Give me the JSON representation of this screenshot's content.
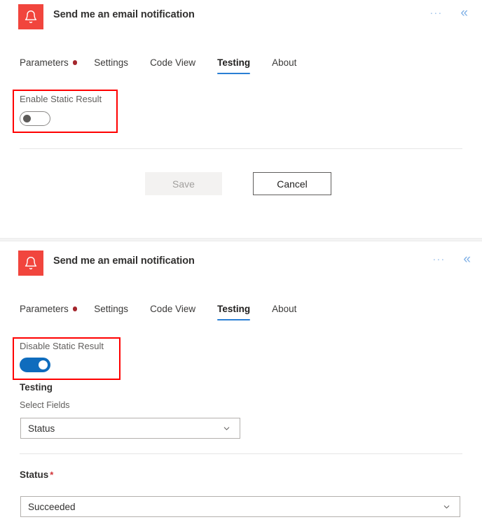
{
  "panels": [
    {
      "header": {
        "icon": "bell-icon",
        "icon_bg": "#f1453d",
        "title": "Send me an email notification",
        "more_label": "···",
        "collapse_label": "«"
      },
      "tabs": [
        {
          "label": "Parameters",
          "active": false,
          "has_dot": true
        },
        {
          "label": "Settings",
          "active": false,
          "has_dot": false
        },
        {
          "label": "Code View",
          "active": false,
          "has_dot": false
        },
        {
          "label": "Testing",
          "active": true,
          "has_dot": false
        },
        {
          "label": "About",
          "active": false,
          "has_dot": false
        }
      ],
      "static_result": {
        "label": "Enable Static Result",
        "toggle_state": "off",
        "highlight_color": "#ff0000"
      },
      "buttons": {
        "save_label": "Save",
        "save_disabled": true,
        "cancel_label": "Cancel"
      }
    },
    {
      "header": {
        "icon": "bell-icon",
        "icon_bg": "#f1453d",
        "title": "Send me an email notification",
        "more_label": "···",
        "collapse_label": "«"
      },
      "tabs": [
        {
          "label": "Parameters",
          "active": false,
          "has_dot": true
        },
        {
          "label": "Settings",
          "active": false,
          "has_dot": false
        },
        {
          "label": "Code View",
          "active": false,
          "has_dot": false
        },
        {
          "label": "Testing",
          "active": true,
          "has_dot": false
        },
        {
          "label": "About",
          "active": false,
          "has_dot": false
        }
      ],
      "static_result": {
        "label": "Disable Static Result",
        "toggle_state": "on",
        "highlight_color": "#ff0000"
      },
      "testing_section": {
        "heading": "Testing",
        "select_fields_label": "Select Fields",
        "select_fields_value": "Status",
        "status_label": "Status",
        "status_required_marker": "*",
        "status_value": "Succeeded"
      }
    }
  ],
  "colors": {
    "accent_blue": "#0f6cbd",
    "tab_underline": "#2a7fd4",
    "dot_red": "#a4262c",
    "highlight_red": "#ff0000",
    "icon_red": "#f1453d",
    "required_red": "#d13438"
  }
}
